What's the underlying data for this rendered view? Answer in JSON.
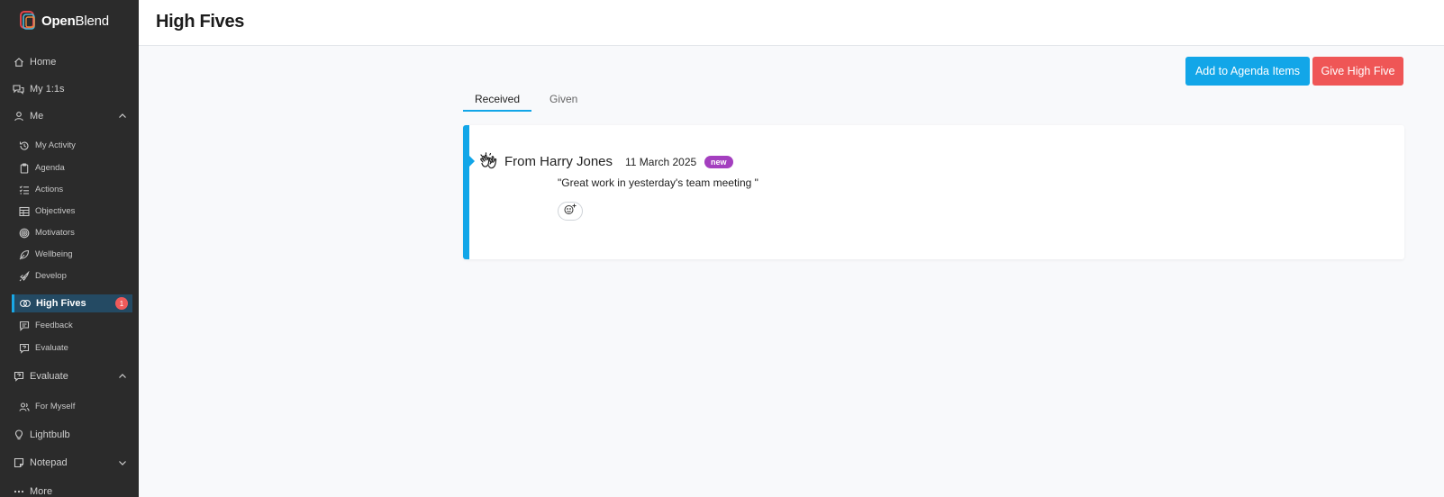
{
  "brand": {
    "name_bold": "Open",
    "name_rest": "Blend"
  },
  "sidebar": {
    "items": [
      {
        "label": "Home",
        "icon": "home-icon"
      },
      {
        "label": "My 1:1s",
        "icon": "chat-icon"
      },
      {
        "label": "Me",
        "icon": "user-icon"
      },
      {
        "label": "My Activity",
        "icon": "history-icon"
      },
      {
        "label": "Agenda",
        "icon": "clipboard-icon"
      },
      {
        "label": "Actions",
        "icon": "checklist-icon"
      },
      {
        "label": "Objectives",
        "icon": "table-icon"
      },
      {
        "label": "Motivators",
        "icon": "target-icon"
      },
      {
        "label": "Wellbeing",
        "icon": "leaf-icon"
      },
      {
        "label": "Develop",
        "icon": "rocket-icon"
      },
      {
        "label": "High Fives",
        "icon": "high-five-icon",
        "badge": "1"
      },
      {
        "label": "Feedback",
        "icon": "message-square-icon"
      },
      {
        "label": "Evaluate",
        "icon": "evaluate-icon"
      },
      {
        "label": "Evaluate",
        "icon": "evaluate-icon"
      },
      {
        "label": "For Myself",
        "icon": "users-icon"
      },
      {
        "label": "Lightbulb",
        "icon": "lightbulb-icon"
      },
      {
        "label": "Notepad",
        "icon": "note-icon"
      },
      {
        "label": "More",
        "icon": "dots-icon"
      }
    ]
  },
  "header": {
    "title": "High Fives"
  },
  "actions": {
    "agenda_label": "Add to Agenda Items",
    "give_label": "Give High Five"
  },
  "tabs": [
    {
      "label": "Received"
    },
    {
      "label": "Given"
    }
  ],
  "high_five": {
    "from": "From Harry Jones",
    "date": "11 March 2025",
    "badge": "new",
    "message": "\"Great work in yesterday's team meeting \""
  },
  "colors": {
    "accent": "#12a6e8",
    "danger": "#ef5656",
    "new_badge": "#a43fbf",
    "sidebar_bg": "#2b2b2b"
  }
}
